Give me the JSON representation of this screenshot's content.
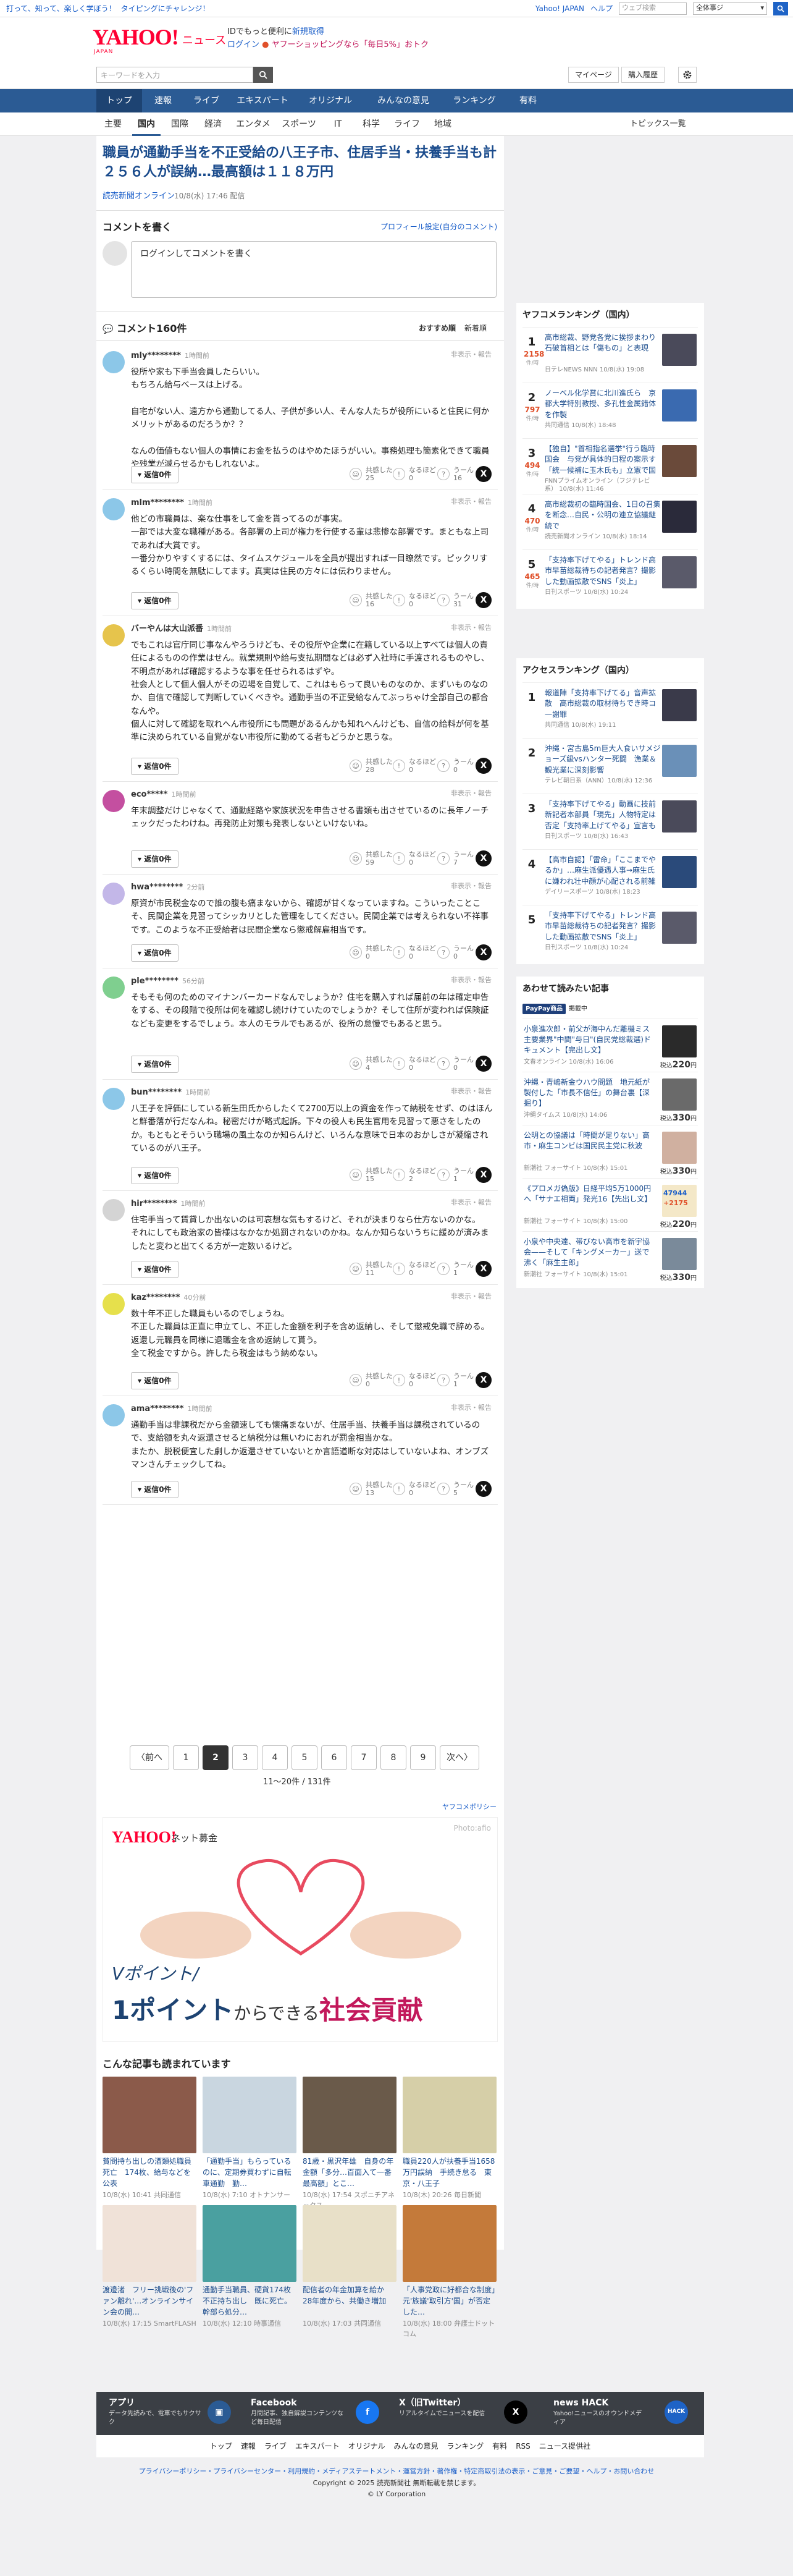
{
  "topbar": {
    "promo1": "打って、知って、楽しく学ぼう！",
    "promo2": "タイピングにチャレンジ！",
    "yahoo_japan": "Yahoo! JAPAN",
    "help": "ヘルプ",
    "search_placeholder": "ウェブ検索",
    "scope": "全体事ジ"
  },
  "header": {
    "logo": "YAHOO!",
    "logo_sub": "JAPAN",
    "news": "ニュース",
    "promo_line1": "IDでもっと便利に",
    "promo_line1_link": "新規取得",
    "promo_login": "ログイン",
    "promo_line2": "ヤフーショッピングなら「毎日5%」おトク"
  },
  "searchbar": {
    "placeholder": "キーワードを入力",
    "mypage": "マイページ",
    "history": "購入履歴"
  },
  "mainnav": [
    "トップ",
    "速報",
    "ライブ",
    "エキスパート",
    "オリジナル",
    "みんなの意見",
    "ランキング",
    "有料"
  ],
  "subnav": {
    "items": [
      "主要",
      "国内",
      "国際",
      "経済",
      "エンタメ",
      "スポーツ",
      "IT",
      "科学",
      "ライフ",
      "地域"
    ],
    "topics": "トピックス一覧"
  },
  "article": {
    "title": "職員が通勤手当を不正受給の八王子市、住居手当・扶養手当も計２５６人が誤納…最高額は１１８万円",
    "source": "読売新聞オンライン",
    "date": "10/8(水) 17:46 配信"
  },
  "comment_write": {
    "title": "コメントを書く",
    "policy": "プロフィール設定(自分のコメント)",
    "placeholder": "ログインしてコメントを書く"
  },
  "comments_header": {
    "title": "コメント160件",
    "sort_recommended": "おすすめ順",
    "sort_new": "新着順"
  },
  "comment_ui": {
    "reply_label": "返信0件",
    "flags": "非表示・報告",
    "agree": "共感した",
    "think": "なるほど",
    "hmm": "うーん",
    "x_label": "X"
  },
  "comments": [
    {
      "user": "mly********",
      "time": "1時間前",
      "text": "役所や家も下手当会員したらいい。\nもちろん給与ベースは上げる。\n\n自宅がない人、遠方から通勤してる人、子供が多い人、そんな人たちが役所にいると住民に何かメリットがあるのだろうか？？\n\nなんの価値もない個人の事情にお金を払うのはやめたほうがいい。事務処理も簡素化できて職員や残業が減らせるかもしれないよ。",
      "agree": "25",
      "think": "0",
      "hmm": "16"
    },
    {
      "user": "mlm********",
      "time": "1時間前",
      "text": "他どの市職員は、楽な仕事をして金を貰ってるのが事実。\n一部では大変な職種がある。各部署の上司が権力を行使する輩は悲惨な部署です。まともな上司であれば大賞です。\n一番分かりやすくするには、タイムスケジュールを全員が提出すれば一目瞭然です。ピックリするくらい時間を無駄にしてます。真実は住民の方々には伝わりません。",
      "agree": "16",
      "think": "0",
      "hmm": "31"
    },
    {
      "user": "バーやんは大山派番",
      "time": "1時間前",
      "text": "でもこれは官庁同じ事なんやろうけども、その役所や企業に在籍している以上すべては個人の責任によるものの作業はせん。就業規則や給与支払期間などは必ず入社時に手渡されるものやし、不明点があれば確認するような事を任せられるはずや。\n社会人として個人個人がその辺場を自覚して、これはもらって良いものなのか、まずいものなのか、自信で確認して判断していくべきや。通勤手当の不正受給なんてぶっちゃけ全部自己の都合なんや。\n個人に対して確認を取れへん市役所にも問題があるんかも知れへんけども、自信の給料が何を基準に決められている自覚がない市役所に勤めてる者もどうかと思うな。",
      "agree": "28",
      "think": "0",
      "hmm": "0"
    },
    {
      "user": "eco*****",
      "time": "1時間前",
      "text": "年末調整だけじゃなくて、通勤経路や家族状況を申告させる書類も出させているのに長年ノーチェックだったわけね。再発防止対策も発表しないといけないね。",
      "agree": "59",
      "think": "0",
      "hmm": "7"
    },
    {
      "user": "hwa********",
      "time": "2分前",
      "text": "原資が市民税金なので誰の腹も痛まないから、確認が甘くなっていますね。こういったことこそ、民間企業を見習ってシッカリとした管理をしてください。民間企業では考えられない不祥事です。このような不正受給者は民間企業なら懲戒解雇相当です。",
      "agree": "0",
      "think": "0",
      "hmm": "0"
    },
    {
      "user": "ple********",
      "time": "56分前",
      "text": "そもそも何のためのマイナンバーカードなんでしょうか？住宅を購入すれば届前の年は確定申告をする、その段階で役所は何を確認し続けけていたのでしょうか？そして住所が変われば保険証なども変更をするでしょう。本人のモラルでもあるが、役所の怠慢でもあると思う。",
      "agree": "4",
      "think": "0",
      "hmm": "0"
    },
    {
      "user": "bun********",
      "time": "1時間前",
      "text": "八王子を評価にしている新生田氏からしたくて2700万以上の資金を作って納税をせず、のはほんと鮮番落が行だなんね。秘密だけが略式起訴。下々の役人も民生官用を見習って悪さをしたのか。もともとそういう職場の風土なのか知らんけど、いろんな意味で日本のおかしさが凝縮されているのが八王子。",
      "agree": "15",
      "think": "2",
      "hmm": "1"
    },
    {
      "user": "hir********",
      "time": "1時間前",
      "text": "住宅手当って賃貸しか出ないのは可哀想な気もするけど、それが決まりなら仕方ないのかな。\nそれにしても政治家の皆様はなかなか処罰されないのかね。なんか知らないうちに緩めが済みましたと変わと出てくる方が一定数いるけど。",
      "agree": "11",
      "think": "0",
      "hmm": "1"
    },
    {
      "user": "kaz********",
      "time": "40分前",
      "text": "数十年不正した職員もいるのでしょうね。\n不正した職員は正直に申立てし、不正した金額を利子を含め返納し、そして懲戒免職で辞める。返還し元職員を同様に退職金を含め返納して貰う。\n全て税金ですから。許したら税金はもう納めない。",
      "agree": "0",
      "think": "0",
      "hmm": "1"
    },
    {
      "user": "ama********",
      "time": "1時間前",
      "text": "通勤手当は非課税だから金額速しても懐痛まないが、住居手当、扶養手当は課税されているので、支給額を丸々返還させると納税分は無いわにおれが罰金相当かな。\nまたか、脱税便宜した劇しか返還させていないとか言語道断な対応はしていないよね、オンブズマンさんチェックしてね。",
      "agree": "13",
      "think": "0",
      "hmm": "5"
    }
  ],
  "pagination": {
    "prev": "〈前へ",
    "pages": [
      "1",
      "2",
      "3",
      "4",
      "5",
      "6",
      "7",
      "8",
      "9"
    ],
    "current": "2",
    "next": "次へ〉",
    "info": "11～20件 / 131件"
  },
  "yahoo_policy": "ヤフコメポリシー",
  "ad": {
    "logo": "YAHOO!",
    "logo_sub": "ネット募金",
    "photo_credit": "Photo:afio",
    "line1": "Vポイント/",
    "line2_part1": "1ポイント",
    "line2_part2": "からできる",
    "line2_part3": "社会貢献"
  },
  "related": {
    "title": "こんな記事も読まれています",
    "items": [
      {
        "text": "貧問持ち出しの酒類処職員死亡　174枚、給与などを公表",
        "src": "共同通信"
      },
      {
        "text": "「通勤手当」もらっているのに、定期券買わずに自転車通勤　勤…",
        "src": "オトナンサー"
      },
      {
        "text": "81歳・黒沢年雄　自身の年金額「多分…百面入て一番最高額」とこ…",
        "src": "スポニチアネックス"
      },
      {
        "text": "職員220人が扶養手当1658万円誤納　手続き怠る　東京・八王子",
        "src": "毎日新聞"
      },
      {
        "text": "渡邊渚　フリー挑戦後の'ファン離れ'…オンラインサイン会の開…",
        "src": "SmartFLASH"
      },
      {
        "text": "通勤手当職員、硬貨174枚不正持ち出し　既に死亡。幹部ら処分…",
        "src": "時事通信"
      },
      {
        "text": "配信者の年金加算を給か　28年度から、共働き増加",
        "src": "共同通信"
      },
      {
        "text": "「人事党政に好都合な制度」元'族議'取引方'国」が否定した…",
        "src": "弁護士ドットコム"
      }
    ],
    "dates": [
      "10/8(水) 10:41",
      "10/8(水) 7:10",
      "10/8(水) 17:54",
      "10/8(木) 20:26",
      "10/8(水) 17:15",
      "10/8(水) 12:10",
      "10/8(水) 17:03",
      "10/8(水) 18:00"
    ]
  },
  "ranking": {
    "title": "ヤフコメランキング（国内）",
    "unit": "件/時",
    "items": [
      {
        "num": "1",
        "count": "2158",
        "text": "高市総裁、野党各党に挨拶まわり　石破首相とは「傷もの」と表現",
        "src": "日テレNEWS NNN\n10/8(水) 19:08"
      },
      {
        "num": "2",
        "count": "797",
        "text": "ノーベル化学賞に北川進氏ら　京都大学特別教授、多孔性金属錯体を作製",
        "src": "共同通信 10/8(水) 18:48"
      },
      {
        "num": "3",
        "count": "494",
        "text": "【独自】\"首相指名選挙\"行う臨時国会　与党が具体的日程の案示す　「統一候補に玉木氏も」立憲で国民に連携呼びかけ",
        "src": "FNNプライムオンライン（フジテレビ系）\n10/8(水) 11:46"
      },
      {
        "num": "4",
        "count": "470",
        "text": "高市総裁初の臨時国会、1日の召集を断念…自民・公明の連立協議継続で",
        "src": "読売新聞オンライン\n10/8(水) 18:14"
      },
      {
        "num": "5",
        "count": "465",
        "text": "「支持率下げてやる」トレンド高市早苗総裁待ちの記者発言？撮影した動画拡散でSNS「炎上」",
        "src": "日刊スポーツ 10/8(水) 10:24"
      }
    ]
  },
  "access_ranking": {
    "title": "アクセスランキング（国内）",
    "items": [
      {
        "num": "1",
        "text": "報道陣「支持率下げてる」音声拡散　高市総裁の取材待ちでき時コ一謝罪",
        "src": "共同通信 10/8(水) 19:11"
      },
      {
        "num": "2",
        "text": "沖縄・宮古島5m巨大人食いサメジョーズ級vsハンター死闘　漁業＆観光業に深刻影響",
        "src": "テレビ朝日系（ANN）10/8(水) 12:36"
      },
      {
        "num": "3",
        "text": "「支持率下げてやる」動画に技前新記者本部員「現先」人物特定は否定「支持率上げてやる」宣言も",
        "src": "日刊スポーツ 10/8(水) 16:43"
      },
      {
        "num": "4",
        "text": "【高市自認】「雷命」「ここまでやるか」…麻生派優遇人事→麻生氏に嫌われ壮中顔が心配される前雑長人類　通常な要職も「ひるおび」も指摘「麻生さんがNOと言ったら」",
        "src": "デイリースポーツ 10/8(水) 18:23"
      },
      {
        "num": "5",
        "text": "「支持率下げてやる」トレンド高市早苗総裁待ちの記者発言？撮影した動画拡散でSNS「炎上」",
        "src": "日刊スポーツ 10/8(水) 10:24"
      }
    ]
  },
  "paypay": {
    "title": "あわせて読みたい記事",
    "badge": "PayPay商品",
    "badge_text": "掲載中",
    "items": [
      {
        "text": "小泉進次郎・前父が海中んだ離機ミス　主要業界\"中間\"与日\"(自民党総裁選)ドキュメント【完出し文】",
        "src": "文春オンライン 10/8(水) 16:06",
        "price": "220"
      },
      {
        "text": "沖縄・青嶋新金ウハウ問題　地元紙が製付した「市長不信任」の舞台裏【深掘り】",
        "src": "沖縄タイムス 10/8(水) 14:06",
        "price": "330"
      },
      {
        "text": "公明との協議は「時間が足りない」高市・麻生コンビは国民民主党に秋波",
        "src": "新潮社 フォーサイト 10/8(水) 15:01",
        "price": "330"
      },
      {
        "text": "《プロメガ偽版》日経平均5万1000円へ「サナエ相両」発光16【先出し文】",
        "src": "新潮社 フォーサイト 10/8(水) 15:00",
        "price": "220"
      },
      {
        "text": "小泉や中央達、帯びない高市を新宇協会——そして「キングメーカー」送で沸く「麻生主郎」",
        "src": "新潮社 フォーサイト 10/8(水) 15:01",
        "price": "330"
      }
    ],
    "ticker_value": "47944",
    "ticker_change": "+2175",
    "price_unit": "円",
    "price_prefix": "税込"
  },
  "footer": {
    "items": [
      {
        "title": "アプリ",
        "text": "データ先読みで、電車でもサクサク"
      },
      {
        "title": "Facebook",
        "text": "月間記事、独自解説コンテンツなど毎日配信"
      },
      {
        "title": "X（旧Twitter）",
        "text": "リアルタイムでニュースを配信"
      },
      {
        "title": "news HACK",
        "text": "Yahoo!ニュースのオウンドメディア"
      }
    ],
    "links": [
      "トップ",
      "速報",
      "ライブ",
      "エキスパート",
      "オリジナル",
      "みんなの意見",
      "ランキング",
      "有料",
      "RSS",
      "ニュース提供社"
    ],
    "legal1": "プライバシーポリシー・プライバシーセンター・利用規約・メディアステートメント・運営方針・著作権・特定商取引法の表示・ご意見・ご要望・ヘルプ・お問い合わせ",
    "copyright": "Copyright © 2025 読売新聞社 無断転載を禁じます。",
    "corp": "© LY Corporation"
  }
}
